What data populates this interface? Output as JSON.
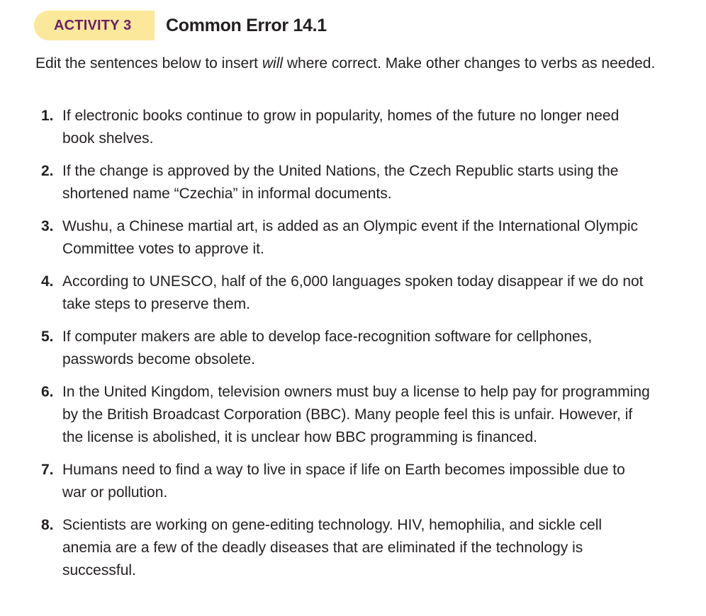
{
  "header": {
    "badge_label": "ACTIVITY 3",
    "title": "Common Error 14.1"
  },
  "instructions": {
    "before": "Edit the sentences below to insert ",
    "emphasis": "will",
    "after": " where correct. Make other changes to verbs as needed."
  },
  "items": [
    {
      "number": "1.",
      "text": "If electronic books continue to grow in popularity, homes of the future no longer need book shelves."
    },
    {
      "number": "2.",
      "text": "If the change is approved by the United Nations, the Czech Republic starts using the shortened name “Czechia” in informal documents."
    },
    {
      "number": "3.",
      "text": "Wushu, a Chinese martial art, is added as an Olympic event if the International Olympic Committee votes to approve it."
    },
    {
      "number": "4.",
      "text": "According to UNESCO, half of the 6,000 languages spoken today disappear if we do not take steps to preserve them."
    },
    {
      "number": "5.",
      "text": "If computer makers are able to develop face-recognition software for cellphones, passwords become obsolete."
    },
    {
      "number": "6.",
      "text": "In the United Kingdom, television owners must buy a license to help pay for programming by the British Broadcast Corporation (BBC). Many people feel this is unfair. However, if the license is abolished, it is unclear how BBC programming is financed."
    },
    {
      "number": "7.",
      "text": "Humans need to find a way to live in space if life on Earth becomes impossible due to war or pollution."
    },
    {
      "number": "8.",
      "text": "Scientists are working on gene-editing technology. HIV, hemophilia, and sickle cell anemia are a few of the deadly diseases that are eliminated if the technology is successful."
    }
  ]
}
